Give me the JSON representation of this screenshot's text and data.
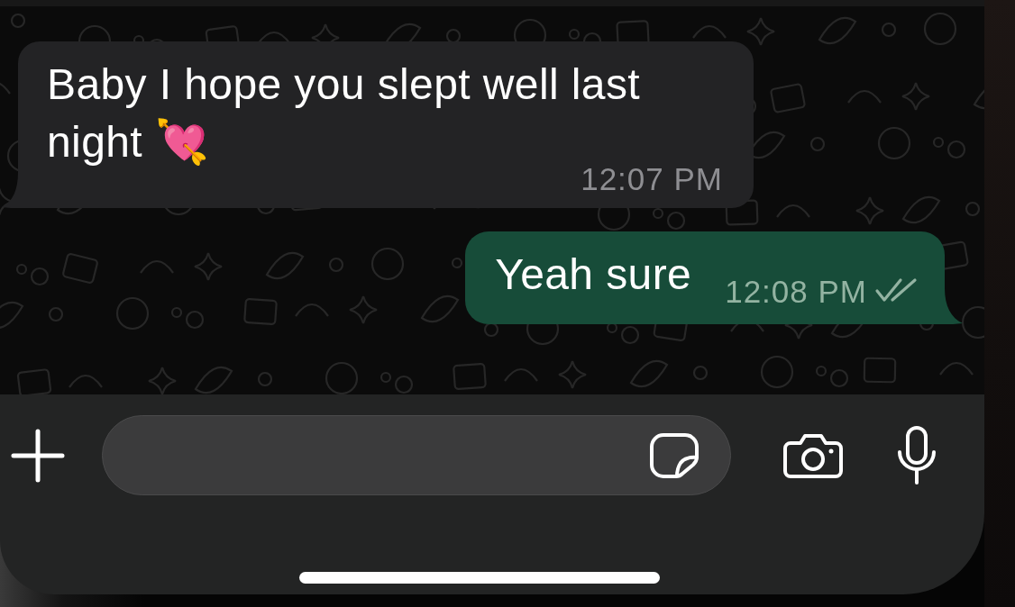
{
  "messages": [
    {
      "kind": "incoming",
      "text": "Baby I hope you slept well last night 💘",
      "time": "12:07 PM"
    },
    {
      "kind": "outgoing",
      "text": "Yeah sure",
      "time": "12:08 PM",
      "read": false
    }
  ]
}
